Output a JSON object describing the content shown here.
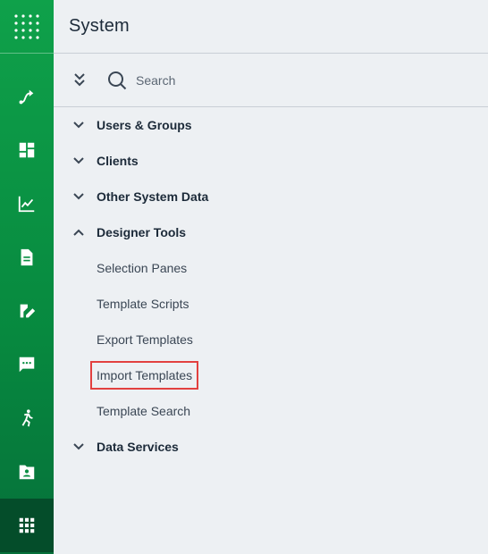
{
  "panel": {
    "title": "System"
  },
  "toolbar": {
    "search_placeholder": "Search"
  },
  "tree": {
    "groups": [
      {
        "label": "Users & Groups",
        "expanded": false
      },
      {
        "label": "Clients",
        "expanded": false
      },
      {
        "label": "Other System Data",
        "expanded": false
      },
      {
        "label": "Designer Tools",
        "expanded": true,
        "children": [
          {
            "label": "Selection Panes"
          },
          {
            "label": "Template Scripts"
          },
          {
            "label": "Export Templates"
          },
          {
            "label": "Import Templates",
            "highlighted": true
          },
          {
            "label": "Template Search"
          }
        ]
      },
      {
        "label": "Data Services",
        "expanded": false
      }
    ]
  },
  "rail": {
    "icons": [
      "apps-grid-icon",
      "route-icon",
      "dashboard-icon",
      "line-chart-icon",
      "document-icon",
      "edit-document-icon",
      "chat-icon",
      "running-person-icon",
      "contact-card-icon",
      "apps-icon"
    ],
    "active": "apps-icon"
  },
  "colors": {
    "rail_green": "#0fa14a",
    "rail_active": "#044d2a",
    "highlight": "#e2403f",
    "panel_bg": "#edf0f3"
  }
}
